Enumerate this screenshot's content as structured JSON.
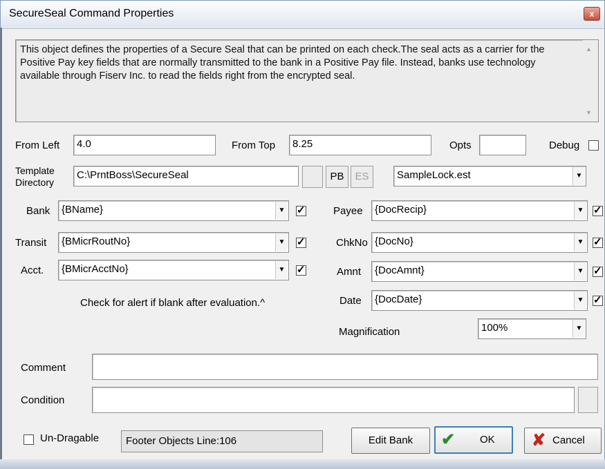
{
  "window": {
    "title": "SecureSeal Command Properties",
    "close_label": "x"
  },
  "description": "This object defines the properties of a Secure Seal that can be printed on each check.The seal acts as a carrier for the Positive Pay key fields that are normally transmitted to the bank in a Positive Pay file. Instead, banks use technology available through Fiserv Inc. to read the fields right from the encrypted seal.",
  "position": {
    "from_left_label": "From Left",
    "from_left_value": "4.0",
    "from_top_label": "From Top",
    "from_top_value": "8.25",
    "opts_label": "Opts",
    "opts_value": "",
    "debug_label": "Debug",
    "debug_checked": false
  },
  "template": {
    "label_line1": "Template",
    "label_line2": "Directory",
    "directory_value": "C:\\PrntBoss\\SecureSeal",
    "browse_label": "",
    "pb_label": "PB",
    "es_label": "ES",
    "file_value": "SampleLock.est"
  },
  "fields_left": [
    {
      "label": "Bank",
      "value": "{BName}",
      "checked": true
    },
    {
      "label": "Transit",
      "value": "{BMicrRoutNo}",
      "checked": true
    },
    {
      "label": "Acct.",
      "value": "{BMicrAcctNo}",
      "checked": true
    }
  ],
  "fields_right": [
    {
      "label": "Payee",
      "value": "{DocRecip}",
      "checked": true
    },
    {
      "label": "ChkNo",
      "value": "{DocNo}",
      "checked": true
    },
    {
      "label": "Amnt",
      "value": "{DocAmnt}",
      "checked": true
    },
    {
      "label": "Date",
      "value": "{DocDate}",
      "checked": true
    }
  ],
  "hint": "Check for alert if blank after evaluation.^",
  "magnification": {
    "label": "Magnification",
    "value": "100%"
  },
  "comment": {
    "label": "Comment",
    "value": ""
  },
  "condition": {
    "label": "Condition",
    "value": ""
  },
  "footer": {
    "undragable_label": "Un-Dragable",
    "undragable_checked": false,
    "status": "Footer Objects  Line:106",
    "edit_bank": "Edit Bank",
    "ok": "OK",
    "cancel": "Cancel"
  },
  "colors": {
    "ok_check": "#2e8b2e",
    "cancel_x": "#c0281e"
  }
}
